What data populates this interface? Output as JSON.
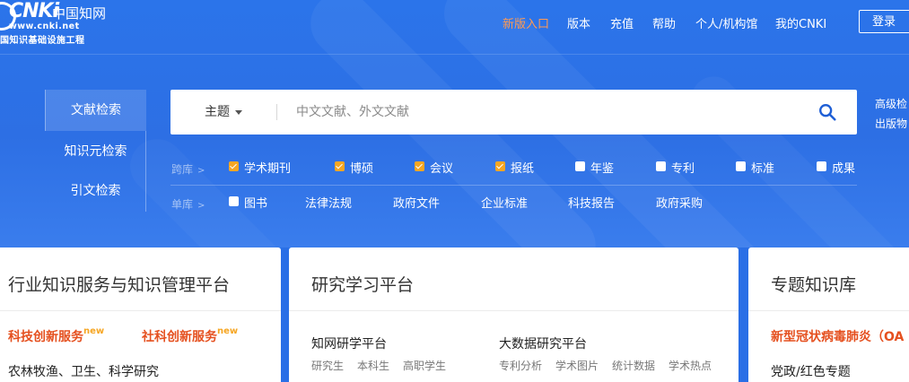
{
  "logo": {
    "main": "CNKi",
    "cn": "中国知网",
    "url": "www.cnki.net",
    "subtitle": "国知识基础设施工程"
  },
  "topnav": {
    "items": [
      "新版入口",
      "版本",
      "充值",
      "帮助",
      "个人/机构馆",
      "我的CNKI"
    ],
    "login": "登录",
    "highlight_color": "#ff9a53"
  },
  "side_tabs": [
    "文献检索",
    "知识元检索",
    "引文检索"
  ],
  "search": {
    "field": "主题",
    "placeholder": "中文文献、外文文献"
  },
  "advanced_links": [
    "高级检",
    "出版物"
  ],
  "cross_library": {
    "label": "跨库",
    "items": [
      {
        "label": "学术期刊",
        "checked": true
      },
      {
        "label": "博硕",
        "checked": true
      },
      {
        "label": "会议",
        "checked": true
      },
      {
        "label": "报纸",
        "checked": true
      },
      {
        "label": "年鉴",
        "checked": false
      },
      {
        "label": "专利",
        "checked": false
      },
      {
        "label": "标准",
        "checked": false
      },
      {
        "label": "成果",
        "checked": false
      }
    ]
  },
  "single_library": {
    "label": "单库",
    "checkbox_item": {
      "label": "图书",
      "checked": false
    },
    "items": [
      "法律法规",
      "政府文件",
      "企业标准",
      "科技报告",
      "政府采购"
    ]
  },
  "cards": [
    {
      "title": "行业知识服务与知识管理平台",
      "links": [
        {
          "label": "科技创新服务",
          "badge": "new"
        },
        {
          "label": "社科创新服务",
          "badge": "new"
        }
      ],
      "text": "农林牧渔、卫生、科学研究"
    },
    {
      "title": "研究学习平台",
      "col1": {
        "heading": "知网研学平台",
        "items": [
          "研究生",
          "本科生",
          "高职学生"
        ]
      },
      "col2": {
        "heading": "大数据研究平台",
        "items": [
          "专利分析",
          "学术图片",
          "统计数据",
          "学术热点"
        ]
      }
    },
    {
      "title": "专题知识库",
      "link": "新型冠状病毒肺炎（OA",
      "text": "党政/红色专题"
    }
  ],
  "colors": {
    "background": "#2b74ea",
    "checkbox_checked": "#f6a623",
    "accent_red": "#e5501f",
    "search_icon": "#1f5fd6"
  }
}
